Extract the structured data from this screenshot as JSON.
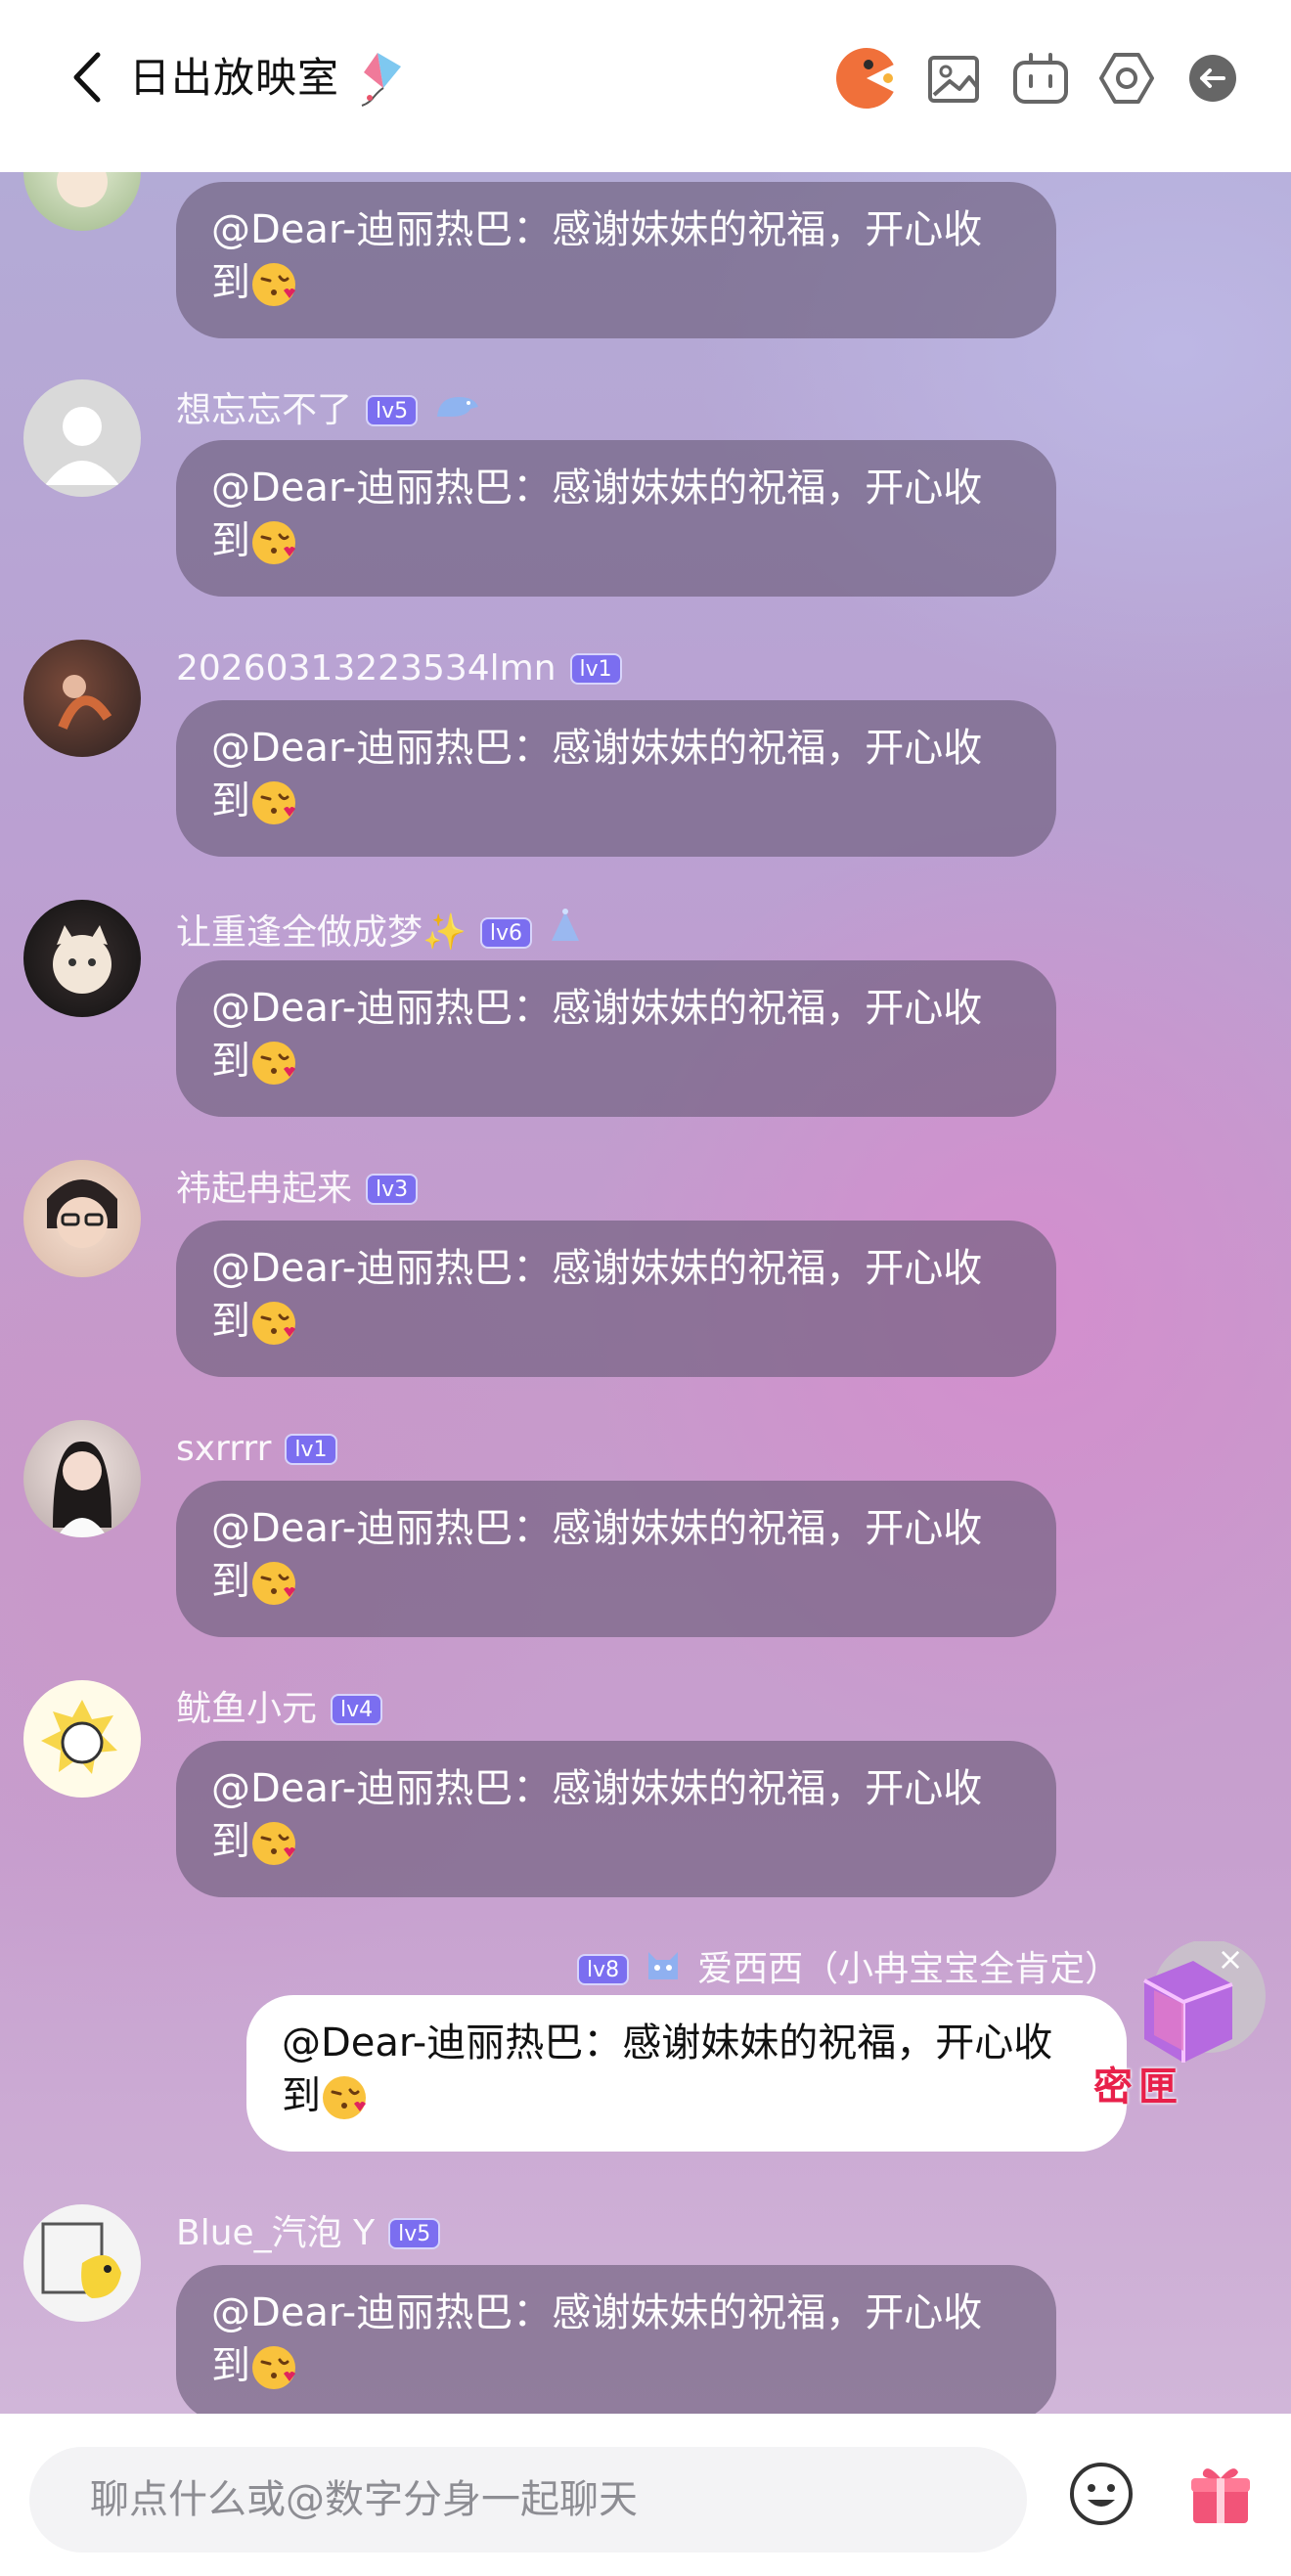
{
  "header": {
    "title": "日出放映室",
    "icons": [
      "back-chevron-icon",
      "kite-icon",
      "pacman-game-icon",
      "image-icon",
      "robot-icon",
      "settings-hexagon-icon",
      "exit-icon"
    ]
  },
  "messages": [
    {
      "name": "",
      "level": "",
      "text": "@Dear-迪丽热巴：感谢妹妹的祝福，开心收到",
      "emoji": "kiss-face-emoji"
    },
    {
      "name": "想忘忘不了",
      "level": "lv5",
      "badge": "blue-dino-icon",
      "text": "@Dear-迪丽热巴：感谢妹妹的祝福，开心收到"
    },
    {
      "name": "20260313223534lmn",
      "level": "lv1",
      "text": "@Dear-迪丽热巴：感谢妹妹的祝福，开心收到"
    },
    {
      "name": "让重逢全做成梦✨",
      "level": "lv6",
      "badge": "blue-hat-icon",
      "text": "@Dear-迪丽热巴：感谢妹妹的祝福，开心收到"
    },
    {
      "name": "祎起冉起来",
      "level": "lv3",
      "text": "@Dear-迪丽热巴：感谢妹妹的祝福，开心收到"
    },
    {
      "name": "sxrrrr",
      "level": "lv1",
      "text": "@Dear-迪丽热巴：感谢妹妹的祝福，开心收到"
    },
    {
      "name": "鱿鱼小元",
      "level": "lv4",
      "text": "@Dear-迪丽热巴：感谢妹妹的祝福，开心收到"
    },
    {
      "name": "爱西西（小冉宝宝全肯定）",
      "level": "lv8",
      "badge": "cat-icon",
      "self": true,
      "text": "@Dear-迪丽热巴：感谢妹妹的祝福，开心收到"
    },
    {
      "name": "Blue_汽泡 Y",
      "level": "lv5",
      "text": "@Dear-迪丽热巴：感谢妹妹的祝福，开心收到"
    }
  ],
  "floating": {
    "label": "密匣",
    "close": "×"
  },
  "input": {
    "placeholder": "聊点什么或@数字分身一起聊天"
  },
  "colors": {
    "level_badge": "#7b6ef0",
    "bubble": "#6a5a78",
    "self_bubble": "#ffffff",
    "accent_orange": "#f0703a"
  }
}
